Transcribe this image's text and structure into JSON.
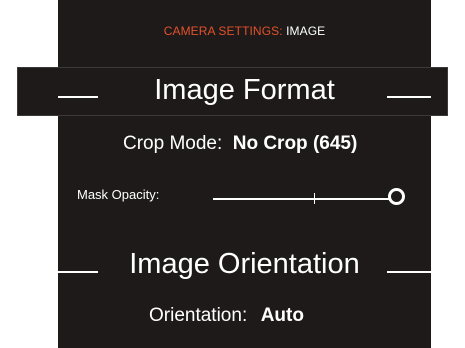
{
  "header": {
    "accent": "CAMERA SETTINGS:",
    "title": "IMAGE"
  },
  "sections": {
    "image_format": {
      "title": "Image Format"
    },
    "image_orientation": {
      "title": "Image Orientation"
    }
  },
  "crop_mode": {
    "label": "Crop Mode:",
    "value": "No Crop (645)"
  },
  "mask_opacity": {
    "label": "Mask Opacity:",
    "level": 1.0
  },
  "orientation": {
    "label": "Orientation:",
    "value": "Auto"
  },
  "colors": {
    "background": "#1e1a1a",
    "accent": "#e2512a",
    "text": "#ffffff"
  }
}
